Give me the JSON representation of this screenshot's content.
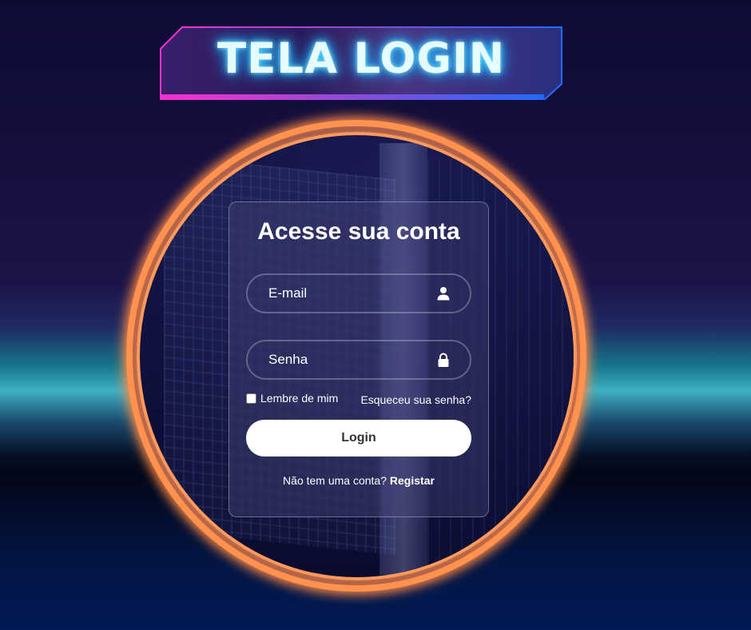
{
  "banner": {
    "title": "TELA LOGIN"
  },
  "login": {
    "heading": "Acesse sua conta",
    "email": {
      "value": "",
      "placeholder": "E-mail",
      "icon": "user-icon"
    },
    "password": {
      "value": "",
      "placeholder": "Senha",
      "icon": "lock-icon"
    },
    "remember_label": "Lembre de mim",
    "remember_checked": false,
    "forgot_link": "Esqueceu sua senha?",
    "submit_label": "Login",
    "register_prompt": "Não tem uma conta?",
    "register_link": "Registar"
  },
  "colors": {
    "ring": "#ff9350",
    "banner_glow": "#27c5ff",
    "banner_left_accent": "#ff2fd1",
    "banner_right_accent": "#1f6bff"
  }
}
